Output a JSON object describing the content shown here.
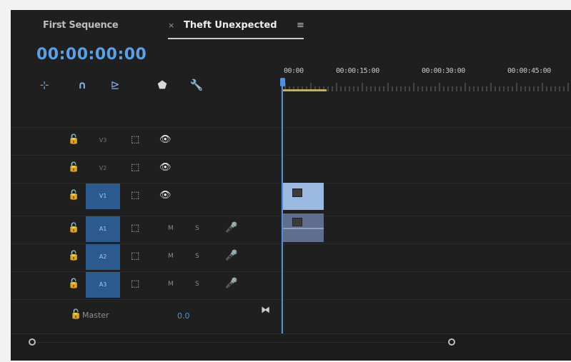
{
  "tabs": {
    "first": "First Sequence",
    "active_close": "×",
    "active": "Theft Unexpected",
    "menu": "≡"
  },
  "timecode": "00:00:00:00",
  "toolbar": {
    "nest_icon": "⊹",
    "snap_icon": "∩",
    "linked_icon": "⊵",
    "marker_icon": "⬟",
    "settings_icon": "🔧"
  },
  "ruler": [
    "00:00",
    "00:00:15:00",
    "00:00:30:00",
    "00:00:45:00"
  ],
  "tracks": [
    {
      "name": "V3",
      "lock": "🔓",
      "sync": "⬚",
      "toggle": "👁"
    },
    {
      "name": "V2",
      "lock": "🔓",
      "sync": "⬚",
      "toggle": "👁"
    },
    {
      "name": "V1",
      "lock": "🔓",
      "sync": "⬚",
      "toggle": "👁"
    },
    {
      "name": "A1",
      "lock": "🔓",
      "sync": "⬚",
      "mute": "M",
      "solo": "S",
      "mic": "🎤"
    },
    {
      "name": "A2",
      "lock": "🔓",
      "sync": "⬚",
      "mute": "M",
      "solo": "S",
      "mic": "🎤"
    },
    {
      "name": "A3",
      "lock": "🔓",
      "sync": "⬚",
      "mute": "M",
      "solo": "S",
      "mic": "🎤"
    }
  ],
  "master": {
    "label": "Master",
    "value": "0.0",
    "lock": "🔓",
    "end_icon": "⧓"
  },
  "colors": {
    "accent": "#4f8fe0",
    "selected_track": "#2b5a8f",
    "clip_video": "#9bb8e0",
    "clip_audio": "#5f6e8c",
    "work_area": "#c9b23b"
  }
}
